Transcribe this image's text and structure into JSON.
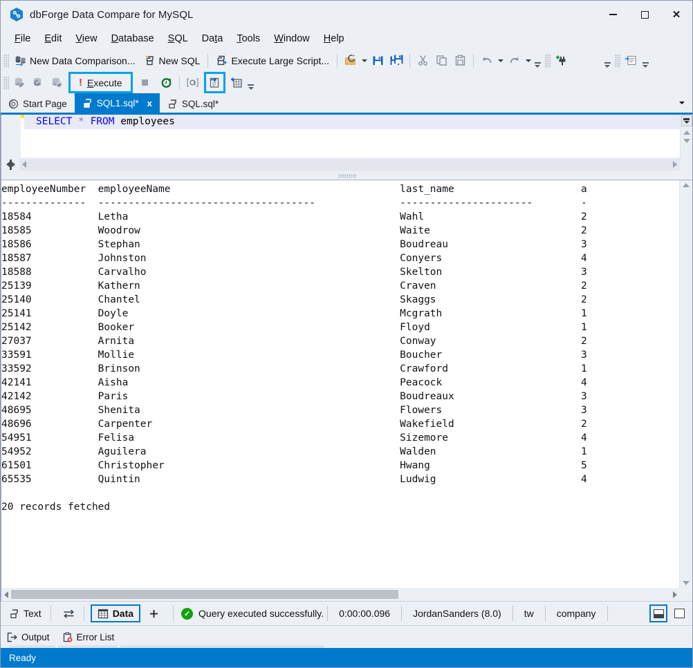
{
  "window": {
    "title": "dbForge Data Compare for MySQL",
    "logo_icon": "dbforge-logo-icon",
    "minimize_label": "Minimize",
    "maximize_label": "Maximize",
    "close_label": "Close"
  },
  "menu": {
    "items": [
      {
        "label": "File",
        "accel": "F"
      },
      {
        "label": "Edit",
        "accel": "E"
      },
      {
        "label": "View",
        "accel": "V"
      },
      {
        "label": "Database",
        "accel": "D"
      },
      {
        "label": "SQL",
        "accel": "S"
      },
      {
        "label": "Data",
        "accel": "t"
      },
      {
        "label": "Tools",
        "accel": "T"
      },
      {
        "label": "Window",
        "accel": "W"
      },
      {
        "label": "Help",
        "accel": "H"
      }
    ]
  },
  "toolbar_main": {
    "new_data_comparison": "New Data Comparison...",
    "new_sql": "New SQL",
    "execute_large_script": "Execute Large Script...",
    "icons": [
      "open-file-icon",
      "open-file-dropdown-icon",
      "save-icon",
      "save-all-icon",
      "cut-icon",
      "copy-icon",
      "paste-icon",
      "undo-icon",
      "undo-dropdown-icon",
      "redo-icon",
      "redo-dropdown-icon",
      "toolbar-overflow-icon",
      "new-connection-icon",
      "toolbar-overflow-2-icon",
      "format-sql-icon"
    ]
  },
  "toolbar_sql": {
    "execute_label": "Execute",
    "execute_accel": "E",
    "icons": [
      "new-query-icon",
      "refresh-query-icon",
      "validate-query-icon",
      "stop-icon",
      "execution-history-icon",
      "query-parameters-icon",
      "execute-to-file-icon",
      "execution-plan-icon",
      "sql-toolbar-overflow-icon"
    ],
    "highlighted": [
      "execute-button",
      "execute-to-file-icon"
    ]
  },
  "tabs": {
    "items": [
      {
        "label": "Start Page",
        "icon": "start-page-icon",
        "active": false,
        "closable": false
      },
      {
        "label": "SQL1.sql*",
        "icon": "sql-document-icon",
        "active": true,
        "closable": true
      },
      {
        "label": "SQL.sql*",
        "icon": "sql-document-icon",
        "active": false,
        "closable": false
      }
    ],
    "close_glyph": "x",
    "overflow_icon": "tab-list-dropdown-icon"
  },
  "editor": {
    "line": {
      "keyword1": "SELECT",
      "star": "*",
      "keyword2": "FROM",
      "identifier": "employees"
    },
    "full_text": "SELECT * FROM employees",
    "change_marker_color": "#ffe900"
  },
  "results": {
    "columns": [
      "employeeNumber",
      "employeeName",
      "last_name",
      "a"
    ],
    "separator_row": [
      "--------------",
      "------------------------------------",
      "----------------------",
      "-"
    ],
    "rows": [
      {
        "employeeNumber": "18584",
        "employeeName": "Letha",
        "last_name": "Wahl",
        "a": "2"
      },
      {
        "employeeNumber": "18585",
        "employeeName": "Woodrow",
        "last_name": "Waite",
        "a": "2"
      },
      {
        "employeeNumber": "18586",
        "employeeName": "Stephan",
        "last_name": "Boudreau",
        "a": "3"
      },
      {
        "employeeNumber": "18587",
        "employeeName": "Johnston",
        "last_name": "Conyers",
        "a": "4"
      },
      {
        "employeeNumber": "18588",
        "employeeName": "Carvalho",
        "last_name": "Skelton",
        "a": "3"
      },
      {
        "employeeNumber": "25139",
        "employeeName": "Kathern",
        "last_name": "Craven",
        "a": "2"
      },
      {
        "employeeNumber": "25140",
        "employeeName": "Chantel",
        "last_name": "Skaggs",
        "a": "2"
      },
      {
        "employeeNumber": "25141",
        "employeeName": "Doyle",
        "last_name": "Mcgrath",
        "a": "1"
      },
      {
        "employeeNumber": "25142",
        "employeeName": "Booker",
        "last_name": "Floyd",
        "a": "1"
      },
      {
        "employeeNumber": "27037",
        "employeeName": "Arnita",
        "last_name": "Conway",
        "a": "2"
      },
      {
        "employeeNumber": "33591",
        "employeeName": "Mollie",
        "last_name": "Boucher",
        "a": "3"
      },
      {
        "employeeNumber": "33592",
        "employeeName": "Brinson",
        "last_name": "Crawford",
        "a": "1"
      },
      {
        "employeeNumber": "42141",
        "employeeName": "Aisha",
        "last_name": "Peacock",
        "a": "4"
      },
      {
        "employeeNumber": "42142",
        "employeeName": "Paris",
        "last_name": "Boudreaux",
        "a": "3"
      },
      {
        "employeeNumber": "48695",
        "employeeName": "Shenita",
        "last_name": "Flowers",
        "a": "3"
      },
      {
        "employeeNumber": "48696",
        "employeeName": "Carpenter",
        "last_name": "Wakefield",
        "a": "2"
      },
      {
        "employeeNumber": "54951",
        "employeeName": "Felisa",
        "last_name": "Sizemore",
        "a": "4"
      },
      {
        "employeeNumber": "54952",
        "employeeName": "Aguilera",
        "last_name": "Walden",
        "a": "1"
      },
      {
        "employeeNumber": "61501",
        "employeeName": "Christopher",
        "last_name": "Hwang",
        "a": "5"
      },
      {
        "employeeNumber": "65535",
        "employeeName": "Quintin",
        "last_name": "Ludwig",
        "a": "4"
      }
    ],
    "footer": "20 records fetched"
  },
  "result_toolbar": {
    "text_tab": "Text",
    "text_icon": "text-output-icon",
    "swap_icon": "swap-panes-icon",
    "data_tab": "Data",
    "data_icon": "data-grid-icon",
    "add_icon": "add-tab-icon",
    "status_icon": "success-check-icon",
    "status_message": "Query executed successfully.",
    "elapsed": "0:00:00.096",
    "connection": "JordanSanders (8.0)",
    "user": "tw",
    "database": "company",
    "layout_split_icon": "layout-split-icon",
    "layout_full_icon": "layout-full-icon"
  },
  "dock": {
    "tabs": [
      {
        "label": "Output",
        "icon": "output-icon"
      },
      {
        "label": "Error List",
        "icon": "error-list-icon"
      }
    ]
  },
  "statusbar": {
    "text": "Ready"
  },
  "colors": {
    "accent": "#007acc",
    "highlight": "#00a2e8",
    "success": "#13a10e",
    "keyword": "#0000ff",
    "error": "#d13438",
    "change_marker": "#ffe900",
    "chrome": "#eceff4"
  }
}
